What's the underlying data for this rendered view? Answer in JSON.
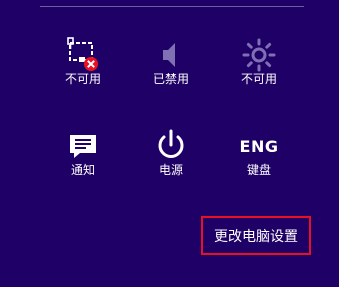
{
  "tiles": [
    {
      "id": "network",
      "icon": "network-unavailable-icon",
      "label": "不可用"
    },
    {
      "id": "volume",
      "icon": "volume-disabled-icon",
      "label": "已禁用"
    },
    {
      "id": "brightness",
      "icon": "brightness-icon",
      "label": "不可用"
    },
    {
      "id": "notifications",
      "icon": "notifications-icon",
      "label": "通知"
    },
    {
      "id": "power",
      "icon": "power-icon",
      "label": "电源"
    },
    {
      "id": "keyboard",
      "icon": "keyboard-eng-icon",
      "icon_text": "ENG",
      "label": "键盘"
    }
  ],
  "change_pc_settings_label": "更改电脑设置",
  "colors": {
    "background": "#1f0066",
    "highlight_border": "#e81123",
    "error_badge": "#e81123",
    "dim_icon": "#7f6fb3"
  }
}
